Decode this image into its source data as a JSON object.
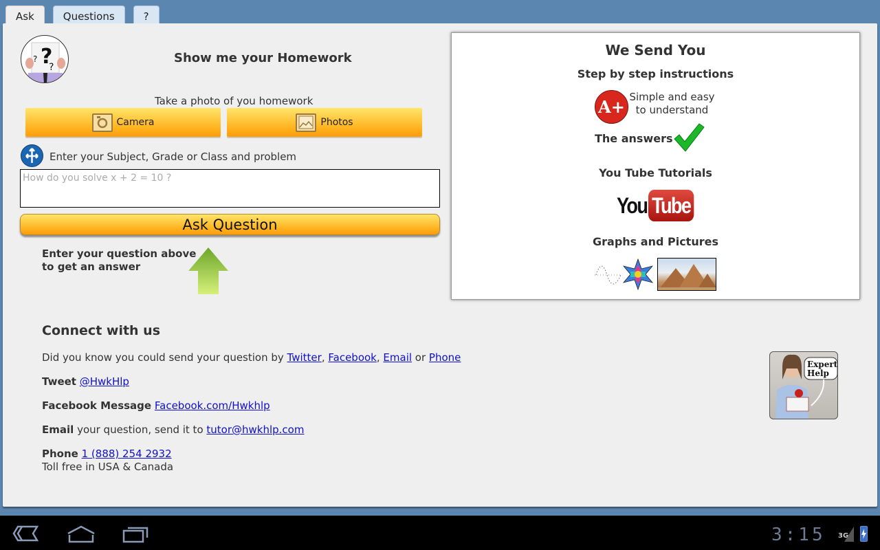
{
  "tabs": [
    {
      "label": "Ask",
      "active": true
    },
    {
      "label": "Questions",
      "active": false
    },
    {
      "label": "?",
      "active": false
    }
  ],
  "ask": {
    "avatar_icon": "question-person-icon",
    "title": "Show me your Homework",
    "photo_hint": "Take a photo of you homework",
    "camera_label": "Camera",
    "photos_label": "Photos",
    "subject_label": "Enter your Subject, Grade or Class and problem",
    "question_value": "",
    "question_placeholder": "How do you solve x + 2 = 10 ?",
    "ask_button": "Ask Question",
    "hint_line1": "Enter your question above",
    "hint_line2": "to get an answer"
  },
  "send": {
    "title": "We Send You",
    "step": "Step by step instructions",
    "aplus": "A+",
    "simple_line1": "Simple and easy",
    "simple_line2": "to understand",
    "answers": "The answers",
    "youtube_title": "You Tube Tutorials",
    "youtube_you": "You",
    "youtube_tube": "Tube",
    "graphs_title": "Graphs and Pictures"
  },
  "connect": {
    "title": "Connect with us",
    "intro_text": "Did you know you could send your question by ",
    "intro_links": [
      "Twitter",
      "Facebook",
      "Email",
      "Phone"
    ],
    "intro_or": " or ",
    "tweet_label": "Tweet",
    "tweet_link": "@HwkHlp",
    "fb_label": "Facebook Message",
    "fb_link": "Facebook.com/Hwkhlp",
    "email_label": "Email",
    "email_text": " your question, send it to ",
    "email_link": "tutor@hwkhlp.com",
    "phone_label": "Phone",
    "phone_link": "1 (888) 254 2932",
    "phone_note": "Toll free in USA & Canada",
    "expert_badge": "Expert Help"
  },
  "system_bar": {
    "time": "3:15",
    "network": "3G"
  },
  "colors": {
    "background": "#5b86b0",
    "button_yellow": "#ffb21f",
    "link": "#1010cc",
    "youtube_red": "#c0261c"
  }
}
